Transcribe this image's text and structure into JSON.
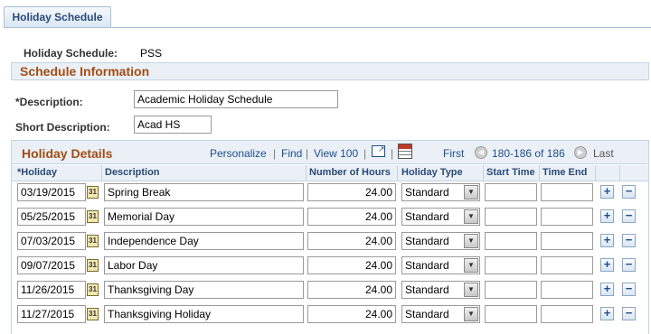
{
  "tab": {
    "label": "Holiday Schedule"
  },
  "header": {
    "schedule_label": "Holiday Schedule:",
    "schedule_value": "PSS"
  },
  "section": {
    "title": "Schedule Information"
  },
  "form": {
    "description_label": "*Description:",
    "description_value": "Academic Holiday Schedule",
    "short_label": "Short Description:",
    "short_value": "Acad HS"
  },
  "grid": {
    "title": "Holiday Details",
    "personalize": "Personalize",
    "find": "Find",
    "view": "View 100",
    "first": "First",
    "range": "180-186 of 186",
    "last": "Last",
    "columns": [
      "*Holiday",
      "Description",
      "Number of Hours",
      "Holiday Type",
      "Start Time",
      "Time End"
    ],
    "rows": [
      {
        "date": "03/19/2015",
        "desc": "Spring Break",
        "hours": "24.00",
        "type": "Standard",
        "start": "",
        "end": ""
      },
      {
        "date": "05/25/2015",
        "desc": "Memorial Day",
        "hours": "24.00",
        "type": "Standard",
        "start": "",
        "end": ""
      },
      {
        "date": "07/03/2015",
        "desc": "Independence Day",
        "hours": "24.00",
        "type": "Standard",
        "start": "",
        "end": ""
      },
      {
        "date": "09/07/2015",
        "desc": "Labor Day",
        "hours": "24.00",
        "type": "Standard",
        "start": "",
        "end": ""
      },
      {
        "date": "11/26/2015",
        "desc": "Thanksgiving Day",
        "hours": "24.00",
        "type": "Standard",
        "start": "",
        "end": ""
      },
      {
        "date": "11/27/2015",
        "desc": "Thanksgiving Holiday",
        "hours": "24.00",
        "type": "Standard",
        "start": "",
        "end": ""
      }
    ]
  },
  "icons": {
    "calendar": "calendar-icon",
    "add": "add-row-icon",
    "delete": "delete-row-icon",
    "dropdown": "chevron-down-icon",
    "zoom": "new-window-icon",
    "download": "download-grid-icon"
  }
}
